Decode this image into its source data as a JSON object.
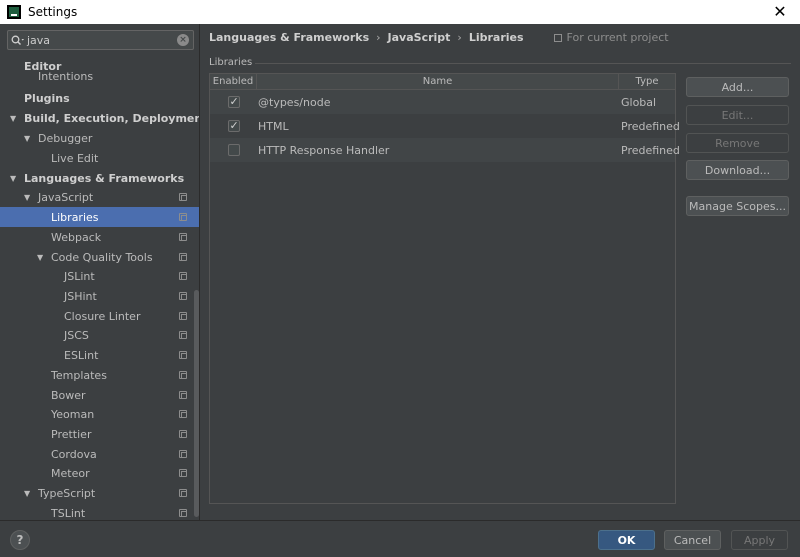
{
  "window": {
    "title": "Settings",
    "close_glyph": "✕"
  },
  "search": {
    "value": "java",
    "icon": "search-icon",
    "clear_glyph": "×"
  },
  "sidebar": {
    "items": [
      {
        "label": "Editor",
        "bold": true,
        "level": 0,
        "arrow": "",
        "proj": false
      },
      {
        "label": "Intentions",
        "bold": false,
        "level": 1,
        "arrow": "",
        "proj": false
      },
      {
        "label": "Plugins",
        "bold": true,
        "level": 0,
        "arrow": "",
        "proj": false
      },
      {
        "label": "Build, Execution, Deployment",
        "bold": true,
        "level": 0,
        "arrow": "▼",
        "proj": false
      },
      {
        "label": "Debugger",
        "bold": false,
        "level": 1,
        "arrow": "▼",
        "proj": false
      },
      {
        "label": "Live Edit",
        "bold": false,
        "level": 2,
        "arrow": "",
        "proj": false
      },
      {
        "label": "Languages & Frameworks",
        "bold": true,
        "level": 0,
        "arrow": "▼",
        "proj": false
      },
      {
        "label": "JavaScript",
        "bold": false,
        "level": 1,
        "arrow": "▼",
        "proj": true
      },
      {
        "label": "Libraries",
        "bold": false,
        "level": 2,
        "arrow": "",
        "proj": true,
        "selected": true
      },
      {
        "label": "Webpack",
        "bold": false,
        "level": 2,
        "arrow": "",
        "proj": true
      },
      {
        "label": "Code Quality Tools",
        "bold": false,
        "level": 2,
        "arrow": "▼",
        "proj": true
      },
      {
        "label": "JSLint",
        "bold": false,
        "level": 3,
        "arrow": "",
        "proj": true
      },
      {
        "label": "JSHint",
        "bold": false,
        "level": 3,
        "arrow": "",
        "proj": true
      },
      {
        "label": "Closure Linter",
        "bold": false,
        "level": 3,
        "arrow": "",
        "proj": true
      },
      {
        "label": "JSCS",
        "bold": false,
        "level": 3,
        "arrow": "",
        "proj": true
      },
      {
        "label": "ESLint",
        "bold": false,
        "level": 3,
        "arrow": "",
        "proj": true
      },
      {
        "label": "Templates",
        "bold": false,
        "level": 2,
        "arrow": "",
        "proj": true
      },
      {
        "label": "Bower",
        "bold": false,
        "level": 2,
        "arrow": "",
        "proj": true
      },
      {
        "label": "Yeoman",
        "bold": false,
        "level": 2,
        "arrow": "",
        "proj": true
      },
      {
        "label": "Prettier",
        "bold": false,
        "level": 2,
        "arrow": "",
        "proj": true
      },
      {
        "label": "Cordova",
        "bold": false,
        "level": 2,
        "arrow": "",
        "proj": true
      },
      {
        "label": "Meteor",
        "bold": false,
        "level": 2,
        "arrow": "",
        "proj": true
      },
      {
        "label": "TypeScript",
        "bold": false,
        "level": 1,
        "arrow": "▼",
        "proj": true
      },
      {
        "label": "TSLint",
        "bold": false,
        "level": 2,
        "arrow": "",
        "proj": true
      }
    ]
  },
  "breadcrumb": {
    "items": [
      "Languages & Frameworks",
      "JavaScript",
      "Libraries"
    ],
    "separator": "›",
    "scope": "For current project"
  },
  "libraries": {
    "section_label": "Libraries",
    "columns": [
      "Enabled",
      "Name",
      "Type"
    ],
    "rows": [
      {
        "enabled": true,
        "name": "@types/node",
        "type": "Global"
      },
      {
        "enabled": true,
        "name": "HTML",
        "type": "Predefined"
      },
      {
        "enabled": false,
        "name": "HTTP Response Handler",
        "type": "Predefined"
      }
    ]
  },
  "buttons": {
    "add": "Add...",
    "edit": "Edit...",
    "remove": "Remove",
    "download": "Download...",
    "manage_scopes": "Manage Scopes..."
  },
  "footer": {
    "help": "?",
    "ok": "OK",
    "cancel": "Cancel",
    "apply": "Apply"
  }
}
